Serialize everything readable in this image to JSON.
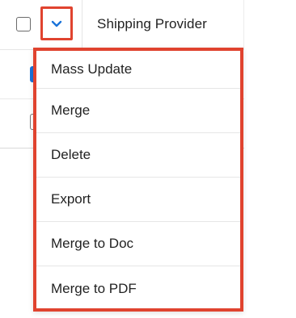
{
  "table": {
    "header": {
      "column_label": "Shipping Provider"
    },
    "rows": [
      {
        "selected": true
      },
      {
        "selected": false
      }
    ]
  },
  "actions_menu": {
    "toggle_icon": "chevron-down-icon",
    "items": [
      {
        "label": "Mass Update"
      },
      {
        "label": "Merge"
      },
      {
        "label": "Delete"
      },
      {
        "label": "Export"
      },
      {
        "label": "Merge to Doc"
      },
      {
        "label": "Merge to PDF"
      }
    ]
  },
  "colors": {
    "highlight": "#e0432f",
    "accent": "#1a73d9",
    "text": "#222222"
  }
}
